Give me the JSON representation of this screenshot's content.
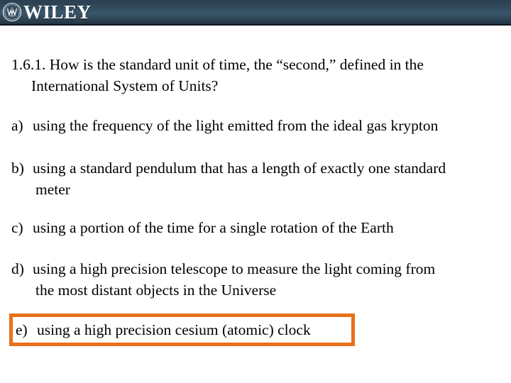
{
  "brand": {
    "name": "WILEY",
    "logo_icon": "wiley-circular-w-emblem",
    "bar_color_top": "#2b3f4f",
    "bar_color_mid": "#3a566b",
    "bar_color_bottom": "#223442"
  },
  "slide": {
    "question": {
      "number": "1.6.1.",
      "line1": "1.6.1. How is the standard unit of time, the “second,” defined in the",
      "line2": "International System of Units?"
    },
    "options": [
      {
        "marker": "a)",
        "line1": "using the frequency of the light emitted from the ideal gas krypton",
        "line2": "",
        "highlighted": false
      },
      {
        "marker": "b)",
        "line1": "using a standard pendulum that has a length of exactly one standard",
        "line2": "meter",
        "highlighted": false
      },
      {
        "marker": "c)",
        "line1": "using a portion of the time for a single rotation of the Earth",
        "line2": "",
        "highlighted": false
      },
      {
        "marker": "d)",
        "line1": "using a high precision telescope to measure the light coming from",
        "line2": "the most distant objects in the Universe",
        "highlighted": false
      },
      {
        "marker": "e)",
        "line1": "using a high precision cesium (atomic) clock",
        "line2": "",
        "highlighted": true
      }
    ],
    "highlight_color": "#e8701a"
  }
}
